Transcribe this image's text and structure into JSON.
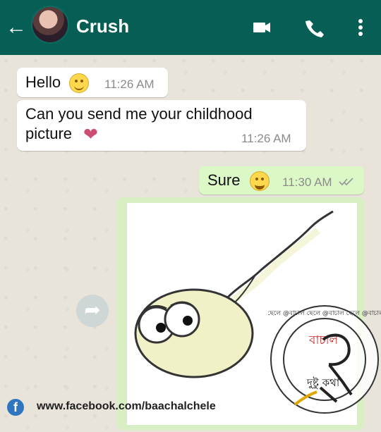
{
  "header": {
    "contact_name": "Crush",
    "back_icon": "arrow-left-icon",
    "video_icon": "video-call-icon",
    "phone_icon": "phone-call-icon",
    "menu_icon": "more-vert-icon",
    "background_color": "#075e54"
  },
  "messages": [
    {
      "text": "Hello",
      "time": "11:26 AM",
      "direction": "incoming",
      "emoji": "smiling-face-icon"
    },
    {
      "text_line1": "Can you send me your childhood",
      "text_line2": "picture",
      "time": "11:26 AM",
      "direction": "incoming",
      "emoji": "heart-icon"
    },
    {
      "text": "Sure",
      "time": "11:30 AM",
      "direction": "outgoing",
      "emoji": "grinning-face-icon",
      "status_icon": "double-check-icon"
    }
  ],
  "shared_image": {
    "caption": "",
    "icon": "sperm-cartoon-illustration"
  },
  "footer": {
    "facebook_url": "www.facebook.com/baachalchele",
    "facebook_icon": "facebook-icon"
  },
  "watermark": {
    "top_text": "বাচাল",
    "bottom_text": "দুষ্টু কথা",
    "ring_text": "বাচাল ছেলে @বাচাল ছেলে @বাচাল ছেলে @বাচাল ছেলে",
    "accent_color": "#c62a2a"
  }
}
